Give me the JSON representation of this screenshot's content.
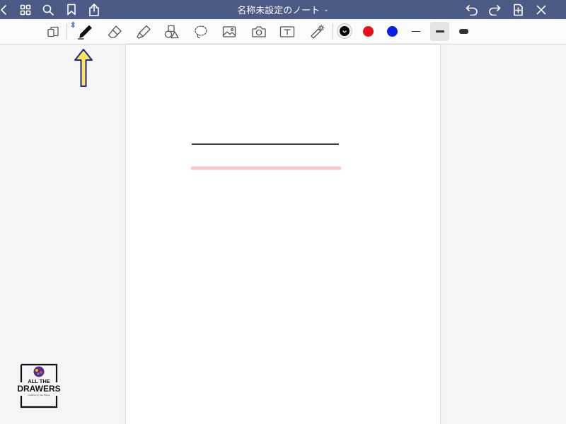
{
  "header": {
    "title": "名称未設定のノート",
    "title_chevron": "⌄"
  },
  "icons": {
    "top_left": [
      "back-icon",
      "thumbnails-grid-icon",
      "search-icon",
      "bookmark-icon",
      "share-icon"
    ],
    "top_right": [
      "undo-icon",
      "redo-icon",
      "add-page-icon",
      "close-icon"
    ],
    "tools": [
      "page-view-icon",
      "pen-icon",
      "eraser-icon",
      "highlighter-icon",
      "shapes-icon",
      "lasso-icon",
      "image-icon",
      "camera-icon",
      "text-box-icon",
      "laser-pointer-icon"
    ],
    "connection": "bluetooth-icon",
    "annotation": "up-arrow-icon"
  },
  "toolbar": {
    "colors": [
      {
        "name": "black",
        "hex": "#000000",
        "selected": true
      },
      {
        "name": "red",
        "hex": "#e8101b",
        "selected": false
      },
      {
        "name": "blue",
        "hex": "#0a1ee6",
        "selected": false
      }
    ],
    "stroke_widths": [
      {
        "name": "thin",
        "selected": false
      },
      {
        "name": "medium",
        "selected": true
      },
      {
        "name": "thick",
        "selected": false
      }
    ]
  },
  "canvas": {
    "strokes": [
      {
        "tool": "pen",
        "color": "#000000"
      },
      {
        "tool": "highlighter",
        "color": "#f9c5c8"
      }
    ]
  },
  "theme": {
    "header_bg": "#4c5b86",
    "annotation_arrow_fill": "#fde35a",
    "annotation_arrow_stroke": "#1c2a8c"
  },
  "watermark": {
    "line1": "ALL THE",
    "line2": "DRAWERS",
    "line3": "creations by Jen Payne"
  }
}
